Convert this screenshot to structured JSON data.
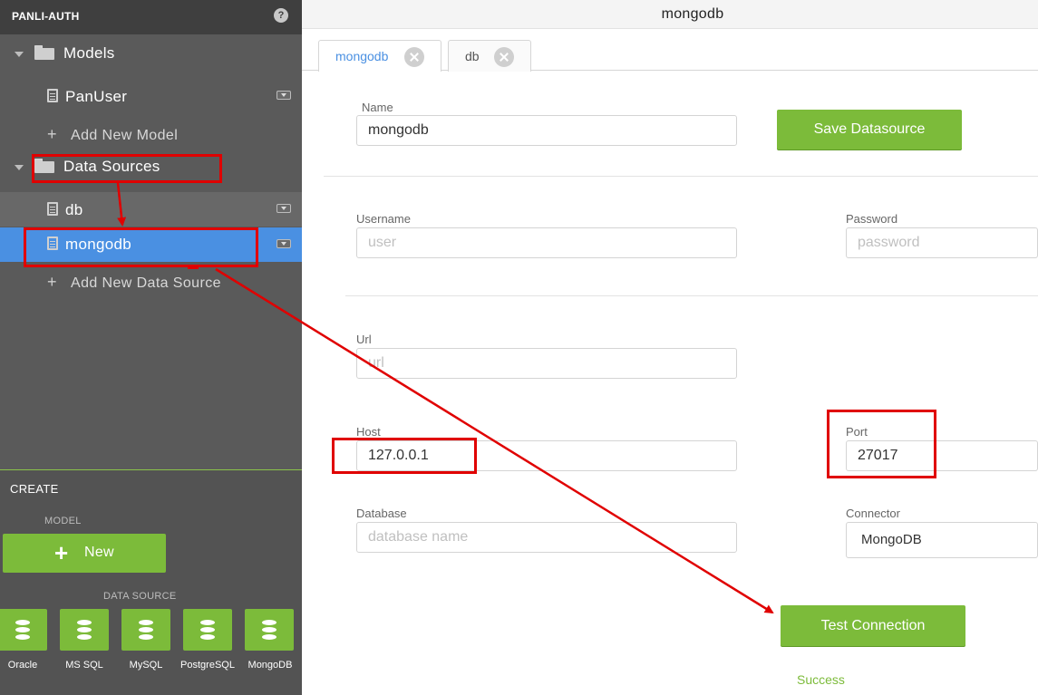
{
  "sidebar": {
    "title": "PANLI-AUTH",
    "help": "?",
    "models": {
      "label": "Models",
      "items": [
        {
          "label": "PanUser"
        }
      ],
      "add_label": "Add New Model"
    },
    "datasources": {
      "label": "Data Sources",
      "items": [
        {
          "label": "db"
        },
        {
          "label": "mongodb"
        }
      ],
      "add_label": "Add New Data Source"
    },
    "create": {
      "title": "CREATE",
      "model_label": "MODEL",
      "new_label": "New",
      "datasource_label": "DATA SOURCE",
      "datasources": [
        "Oracle",
        "MS SQL",
        "MySQL",
        "PostgreSQL",
        "MongoDB"
      ]
    }
  },
  "main": {
    "title": "mongodb",
    "tabs": [
      {
        "label": "mongodb"
      },
      {
        "label": "db"
      }
    ],
    "form": {
      "name_label": "Name",
      "name_value": "mongodb",
      "save_label": "Save Datasource",
      "username_label": "Username",
      "username_placeholder": "user",
      "password_label": "Password",
      "password_placeholder": "password",
      "url_label": "Url",
      "url_placeholder": "url",
      "host_label": "Host",
      "host_value": "127.0.0.1",
      "port_label": "Port",
      "port_value": "27017",
      "database_label": "Database",
      "database_placeholder": "database name",
      "connector_label": "Connector",
      "connector_value": "MongoDB",
      "test_label": "Test Connection",
      "status": "Success"
    }
  },
  "colors": {
    "accent_green": "#7cbb3a",
    "selection_blue": "#4a90e2",
    "annotation_red": "#e00000"
  }
}
